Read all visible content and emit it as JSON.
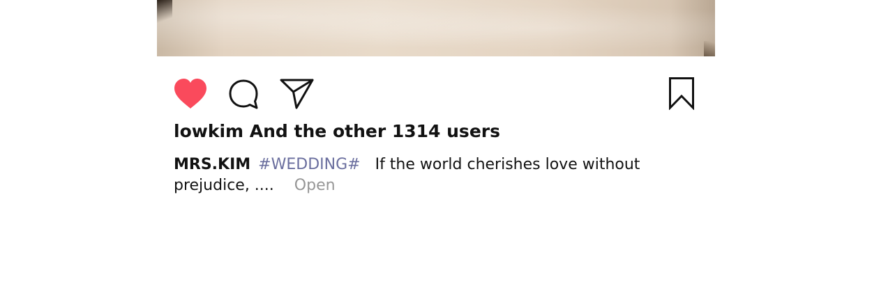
{
  "post": {
    "image_alt": "wedding dress photo",
    "actions": {
      "like_icon": "heart-icon",
      "like_color": "#fa4a5c",
      "comment_icon": "comment-bubble-icon",
      "share_icon": "paper-plane-icon",
      "save_icon": "bookmark-icon"
    },
    "likes_text": "lowkim And the other 1314 users",
    "caption": {
      "username": "MRS.KIM",
      "hashtag": "#WEDDING#",
      "text": "If the world cherishes love without prejudice, ....",
      "open_label": "Open",
      "hashtag_color": "#6a6e9e",
      "open_color": "#969696"
    }
  }
}
